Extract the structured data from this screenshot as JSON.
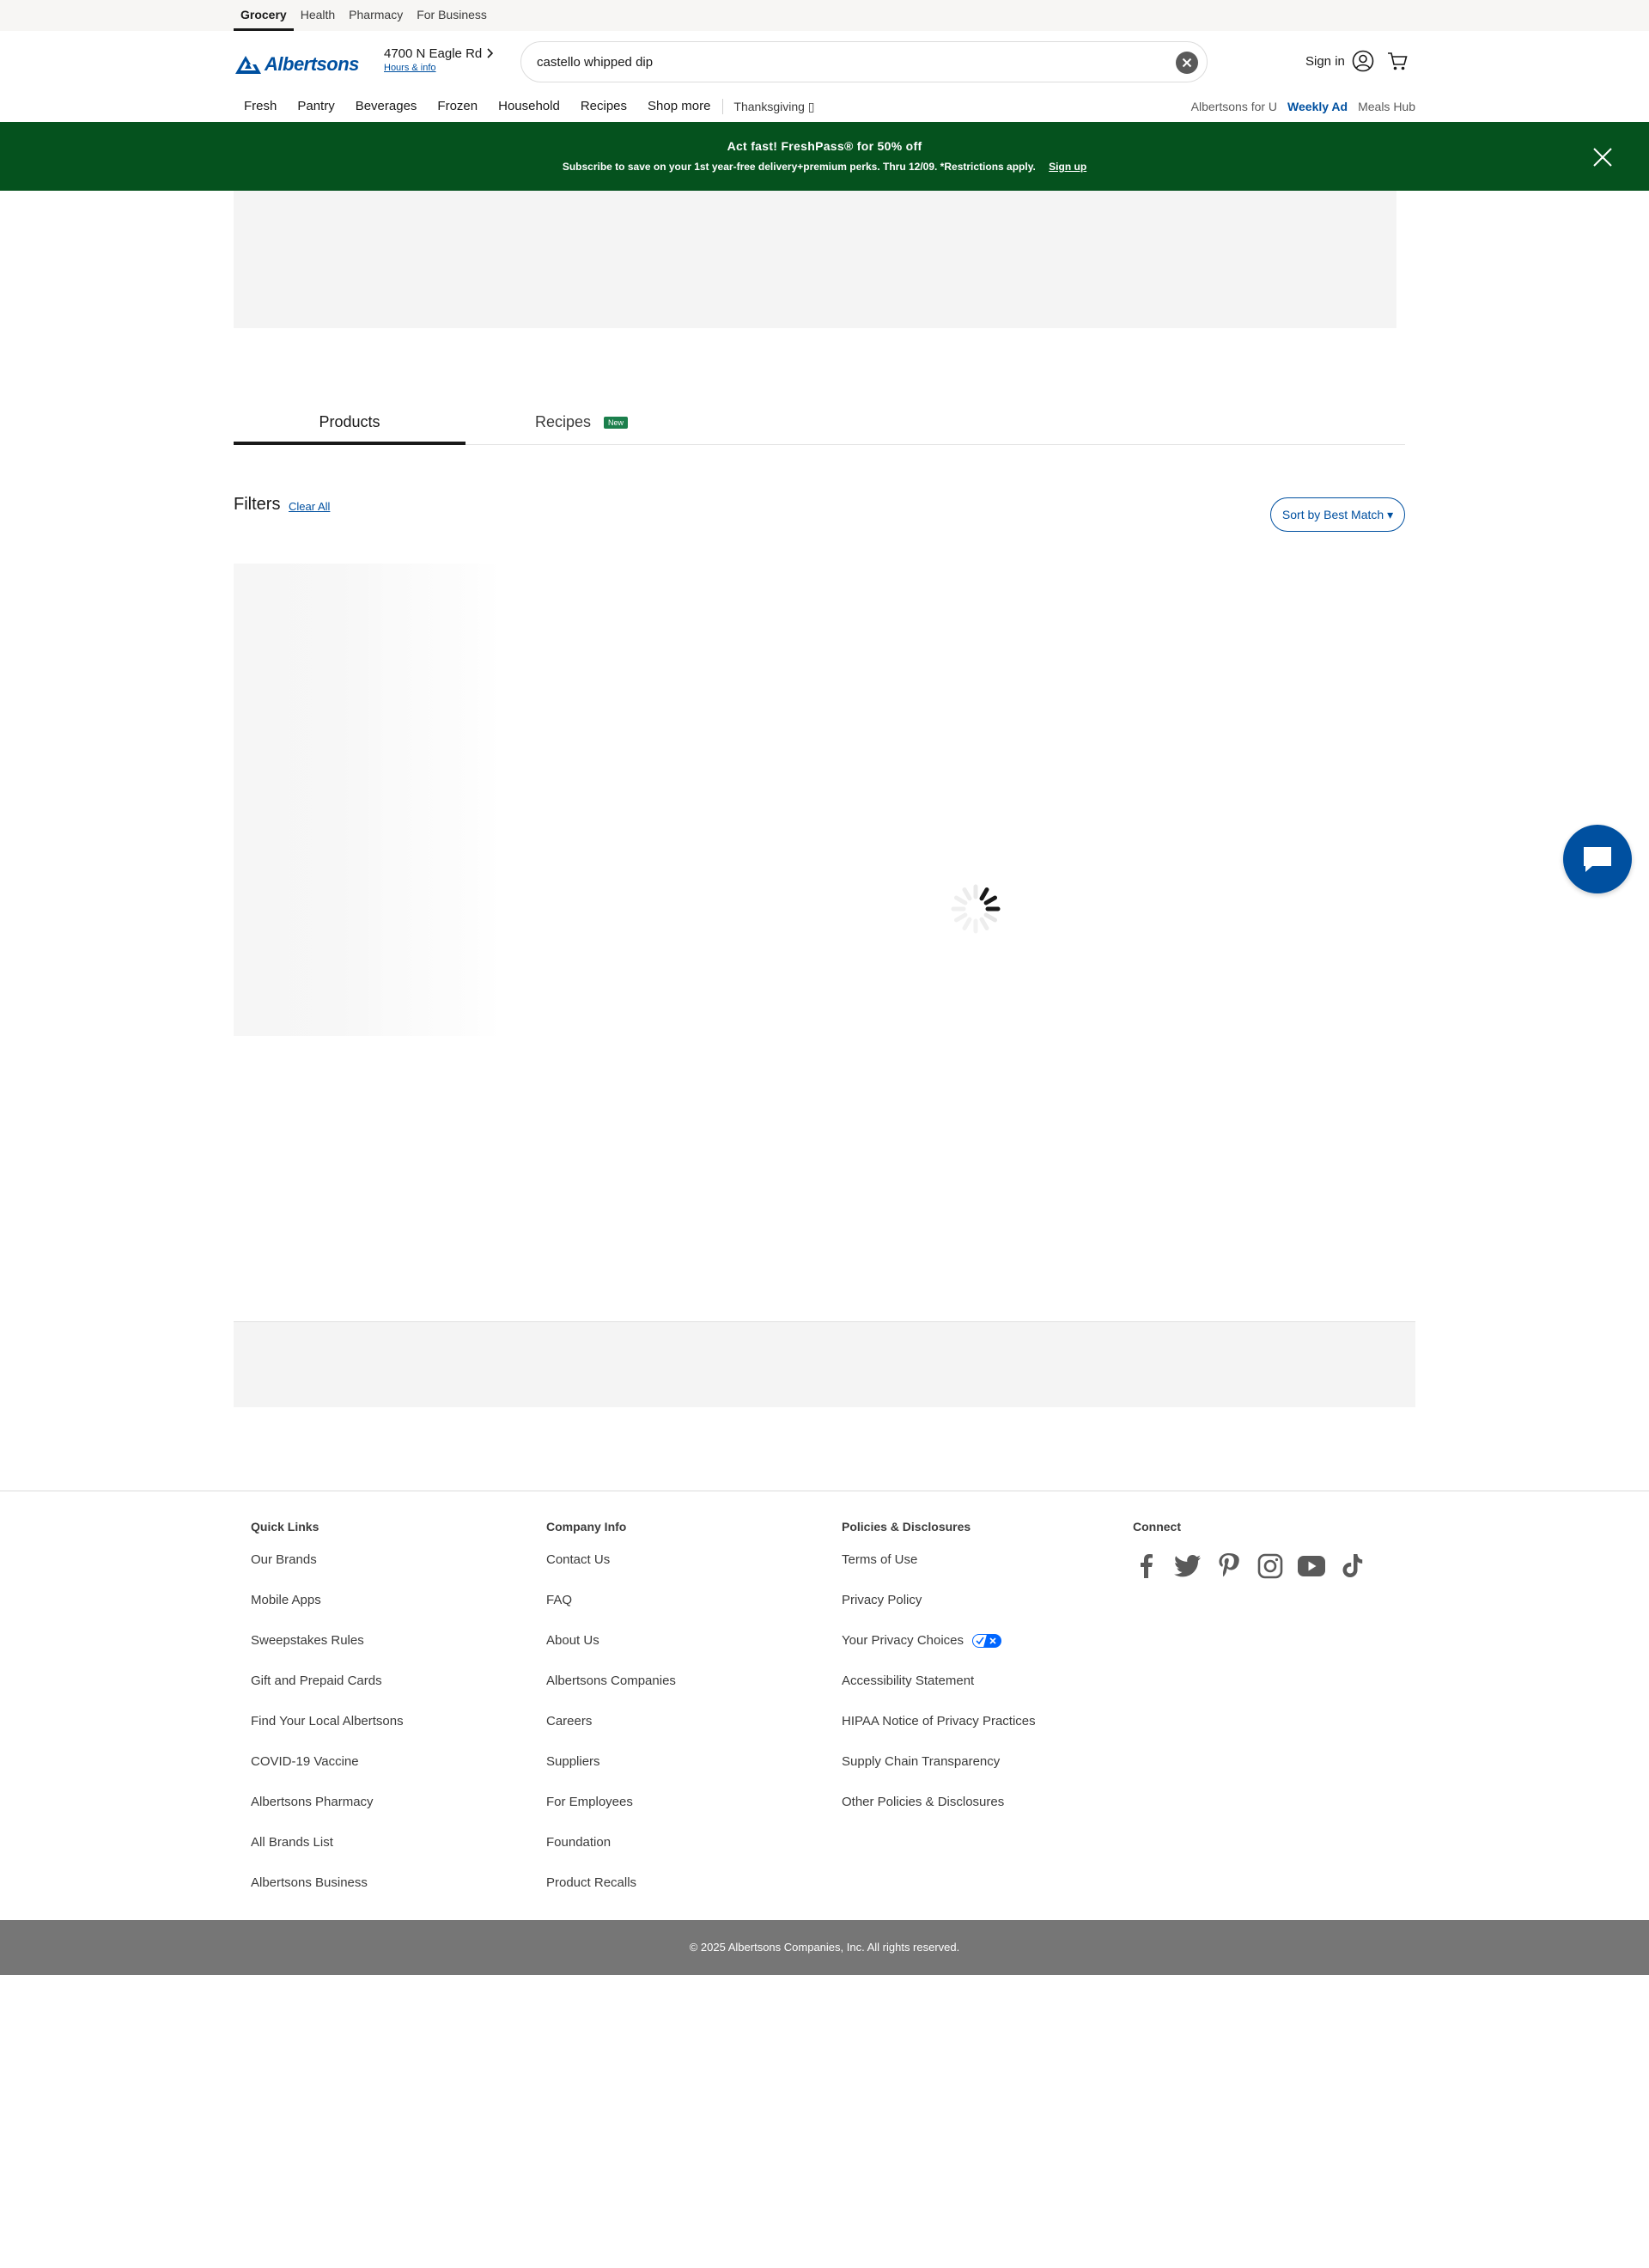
{
  "utility_tabs": [
    "Grocery",
    "Health",
    "Pharmacy",
    "For Business"
  ],
  "header": {
    "logo_text": "Albertsons",
    "store_address": "4700 N Eagle Rd",
    "store_hours_link": "Hours & info",
    "search_value": "castello whipped dip",
    "signin_label": "Sign in"
  },
  "nav": {
    "items": [
      "Fresh",
      "Pantry",
      "Beverages",
      "Frozen",
      "Household",
      "Recipes",
      "Shop more"
    ],
    "promo_item": "Thanksgiving ▯",
    "right_items": [
      "Albertsons for U",
      "Weekly Ad",
      "Meals Hub"
    ]
  },
  "banner": {
    "title": "Act fast! FreshPass® for 50% off",
    "subtitle": "Subscribe to save on your 1st year-free delivery+premium perks. Thru 12/09. *Restrictions apply.",
    "signup": "Sign up"
  },
  "tabs": {
    "products": "Products",
    "recipes": "Recipes",
    "recipes_badge": "New"
  },
  "filters": {
    "title": "Filters",
    "clear_all": "Clear All",
    "sort_label": "Sort by Best Match ▾"
  },
  "footer": {
    "quick_links": {
      "title": "Quick Links",
      "links": [
        "Our Brands",
        "Mobile Apps",
        "Sweepstakes Rules",
        "Gift and Prepaid Cards",
        "Find Your Local Albertsons",
        "COVID-19 Vaccine",
        "Albertsons Pharmacy",
        "All Brands List",
        "Albertsons Business"
      ]
    },
    "company_info": {
      "title": "Company Info",
      "links": [
        "Contact Us",
        "FAQ",
        "About Us",
        "Albertsons Companies",
        "Careers",
        "Suppliers",
        "For Employees",
        "Foundation",
        "Product Recalls"
      ]
    },
    "policies": {
      "title": "Policies & Disclosures",
      "links": [
        "Terms of Use",
        "Privacy Policy",
        "Your Privacy Choices",
        "Accessibility Statement",
        "HIPAA Notice of Privacy Practices",
        "Supply Chain Transparency",
        "Other Policies & Disclosures"
      ]
    },
    "connect": {
      "title": "Connect",
      "icons": [
        "facebook-icon",
        "twitter-icon",
        "pinterest-icon",
        "instagram-icon",
        "youtube-icon",
        "tiktok-icon"
      ]
    },
    "copyright": "© 2025 Albertsons Companies, Inc.  All rights reserved."
  },
  "colors": {
    "brand_blue": "#0050a0",
    "banner_green": "#05521e",
    "copyright_bg": "#767676"
  }
}
